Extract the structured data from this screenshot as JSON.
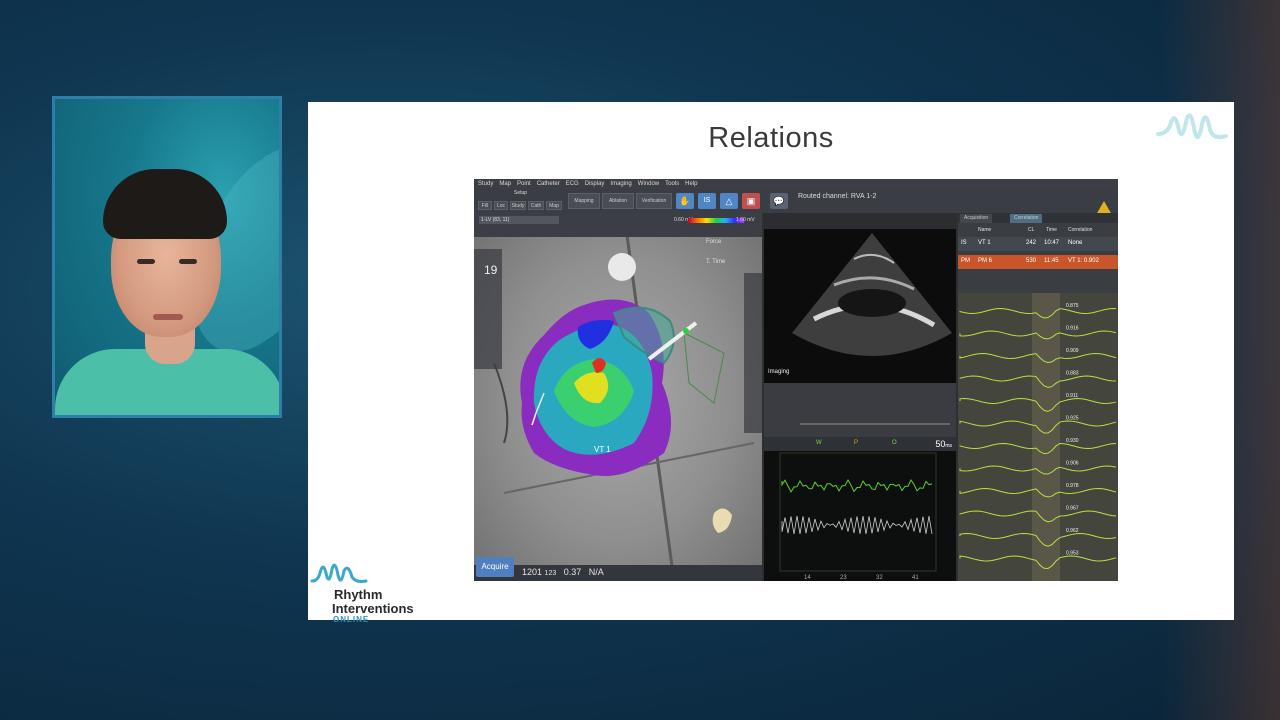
{
  "slide": {
    "title": "Relations",
    "logo": {
      "line1": "Rhythm",
      "line2": "Interventions",
      "line3": "ONLINE"
    }
  },
  "carto": {
    "menu": [
      "Study",
      "Map",
      "Point",
      "Catheter",
      "ECG",
      "Display",
      "Imaging",
      "Window",
      "Tools",
      "Help"
    ],
    "setup_label": "Setup",
    "toolbar_buttons": [
      "Fill",
      "Loc",
      "Study",
      "Cath",
      "Map"
    ],
    "mapping_label": "Mapping",
    "ablation_label": "Ablation",
    "verification_label": "Verification",
    "routed_channel": "Routed channel: RVA 1-2",
    "map_dropdown": "1-LV (83, 11)",
    "colorbar_min": "0.60 mV",
    "colorbar_max": "1.60 mV",
    "force_label": "Force",
    "ttime_label": "T. Time",
    "map_counter": "19",
    "acquire_label": "Acquire",
    "status_points": "1201",
    "status_sub": "123",
    "status_value": "0.37",
    "status_na": "N/A",
    "vt_label": "VT 1",
    "imaging_label": "Imaging",
    "sweep_speed": "50",
    "sweep_unit": "ms",
    "wave_letters": [
      "W",
      "P",
      "O"
    ],
    "x_ticks": [
      "14",
      "23",
      "32",
      "41"
    ],
    "tabs": [
      "Acquisition",
      "Correlation"
    ],
    "corr_headers": {
      "name": "Name",
      "cl": "CL",
      "time": "Time",
      "correlation": "Correlation"
    },
    "corr_rows": [
      {
        "tag": "IS",
        "name": "VT 1",
        "cl": "242",
        "time": "10:47",
        "corr": "None"
      },
      {
        "tag": "PM",
        "name": "PM 6",
        "cl": "530",
        "time": "11:45",
        "corr": "VT 1: 0.902"
      }
    ],
    "ecg_values": [
      "0.875",
      "0.916",
      "0.909",
      "0.883",
      "0.911",
      "0.925",
      "0.930",
      "0.906",
      "0.978",
      "0.967",
      "0.962",
      "0.953"
    ]
  }
}
